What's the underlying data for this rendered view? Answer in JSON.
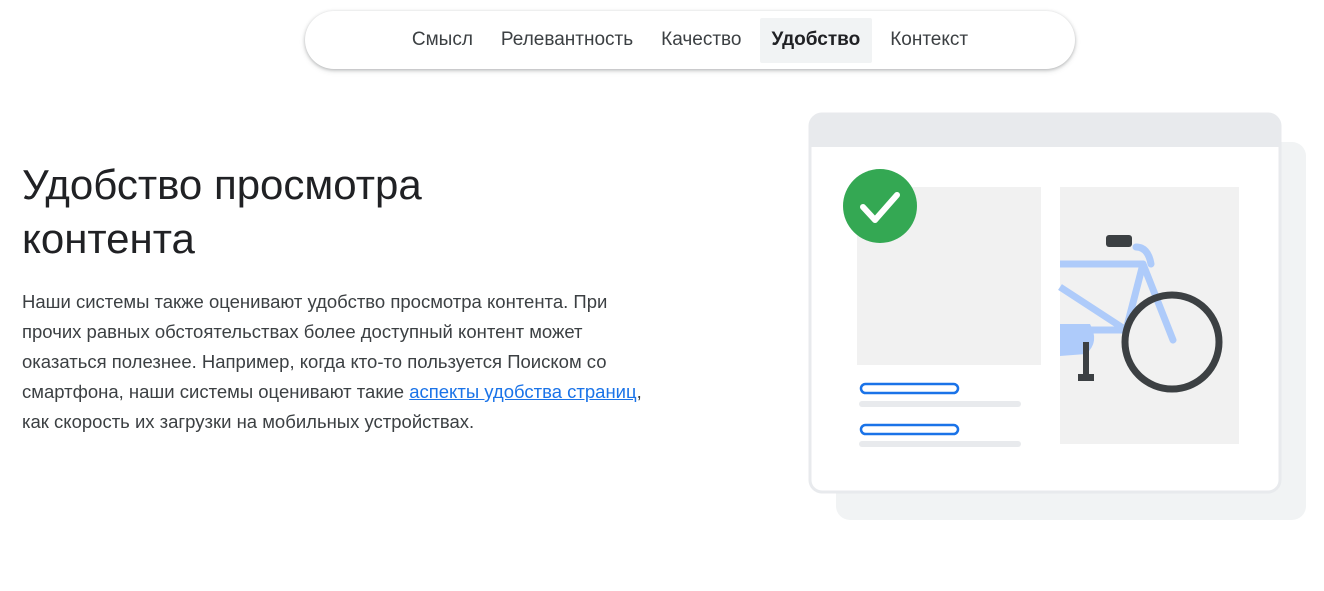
{
  "tabs": [
    {
      "label": "Смысл",
      "active": false
    },
    {
      "label": "Релевантность",
      "active": false
    },
    {
      "label": "Качество",
      "active": false
    },
    {
      "label": "Удобство",
      "active": true
    },
    {
      "label": "Контекст",
      "active": false
    }
  ],
  "section": {
    "heading": "Удобство просмотра контента",
    "text_before_link": "Наши системы также оценивают удобство просмотра контента. При прочих равных обстоятельствах более доступный контент может оказаться полезнее. Например, когда кто-то пользуется Поиском со смартфона, наши системы оценивают такие ",
    "link_text": "аспекты удобства страниц",
    "text_after_link": ", как скорость их загрузки на мобильных устройствах."
  },
  "illustration": {
    "icons": [
      "checkmark-icon",
      "bicycle-icon"
    ],
    "colors": {
      "check_green": "#34a853",
      "bike_frame": "#aecbfa",
      "wheel": "#3c4043",
      "link_blue": "#1a73e8",
      "panel_gray": "#f1f1f1",
      "shadow_gray": "#f1f3f4"
    }
  }
}
